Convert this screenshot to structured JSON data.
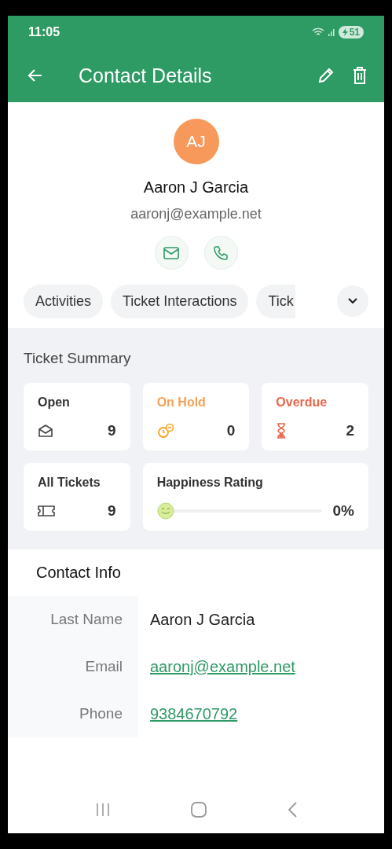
{
  "status_bar": {
    "time": "11:05",
    "battery": "51"
  },
  "app_bar": {
    "title": "Contact Details"
  },
  "contact": {
    "initials": "AJ",
    "name": "Aaron J Garcia",
    "email": "aaronj@example.net"
  },
  "tabs": [
    {
      "label": "Activities"
    },
    {
      "label": "Ticket Interactions"
    },
    {
      "label": "Tick"
    }
  ],
  "ticket_summary": {
    "title": "Ticket Summary",
    "cards": [
      {
        "kind": "open",
        "label": "Open",
        "count": "9",
        "color": "#333333"
      },
      {
        "kind": "on_hold",
        "label": "On Hold",
        "count": "0",
        "color": "#f4a25a"
      },
      {
        "kind": "overdue",
        "label": "Overdue",
        "count": "2",
        "color": "#e8674a"
      },
      {
        "kind": "all",
        "label": "All Tickets",
        "count": "9",
        "color": "#333333"
      }
    ],
    "happiness": {
      "label": "Happiness Rating",
      "level": 0,
      "reading": "0%"
    }
  },
  "contact_info": {
    "title": "Contact Info",
    "rows": [
      {
        "kind": "text",
        "label": "Last Name",
        "value": "Aaron J Garcia"
      },
      {
        "kind": "link",
        "label": "Email",
        "value": "aaronj@example.net"
      },
      {
        "kind": "link",
        "label": "Phone",
        "value": "9384670792"
      }
    ]
  }
}
